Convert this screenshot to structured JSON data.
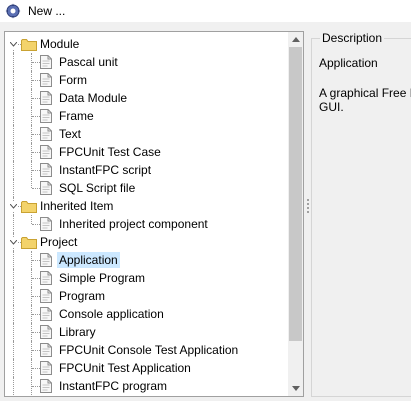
{
  "window": {
    "title": "New ...",
    "icon": "cog-icon"
  },
  "tree": {
    "selected": "Application",
    "items": [
      {
        "label": "Module",
        "level": 0,
        "type": "folder",
        "expanded": true,
        "last": false
      },
      {
        "label": "Pascal unit",
        "level": 1,
        "type": "file",
        "last": false
      },
      {
        "label": "Form",
        "level": 1,
        "type": "file",
        "last": false
      },
      {
        "label": "Data Module",
        "level": 1,
        "type": "file",
        "last": false
      },
      {
        "label": "Frame",
        "level": 1,
        "type": "file",
        "last": false
      },
      {
        "label": "Text",
        "level": 1,
        "type": "file",
        "last": false
      },
      {
        "label": "FPCUnit Test Case",
        "level": 1,
        "type": "file",
        "last": false
      },
      {
        "label": "InstantFPC script",
        "level": 1,
        "type": "file",
        "last": false
      },
      {
        "label": "SQL Script file",
        "level": 1,
        "type": "file",
        "last": true
      },
      {
        "label": "Inherited Item",
        "level": 0,
        "type": "folder",
        "expanded": true,
        "last": false
      },
      {
        "label": "Inherited project component",
        "level": 1,
        "type": "file",
        "last": true
      },
      {
        "label": "Project",
        "level": 0,
        "type": "folder",
        "expanded": true,
        "last": false
      },
      {
        "label": "Application",
        "level": 1,
        "type": "file",
        "last": false
      },
      {
        "label": "Simple Program",
        "level": 1,
        "type": "file",
        "last": false
      },
      {
        "label": "Program",
        "level": 1,
        "type": "file",
        "last": false
      },
      {
        "label": "Console application",
        "level": 1,
        "type": "file",
        "last": false
      },
      {
        "label": "Library",
        "level": 1,
        "type": "file",
        "last": false
      },
      {
        "label": "FPCUnit Console Test Application",
        "level": 1,
        "type": "file",
        "last": false
      },
      {
        "label": "FPCUnit Test Application",
        "level": 1,
        "type": "file",
        "last": false
      },
      {
        "label": "InstantFPC program",
        "level": 1,
        "type": "file",
        "last": false
      }
    ],
    "scrollbar": {
      "thumb_start": 0.0,
      "thumb_fraction": 0.88
    }
  },
  "description": {
    "legend": "Description",
    "name": "Application",
    "text": "A graphical Free Pascal application using the LCL. The program file is automatically maintained by Lazarus.\nGUI."
  },
  "colors": {
    "selection": "#cce8ff",
    "folder": "#f3d36b",
    "folder_edge": "#c9a232"
  }
}
